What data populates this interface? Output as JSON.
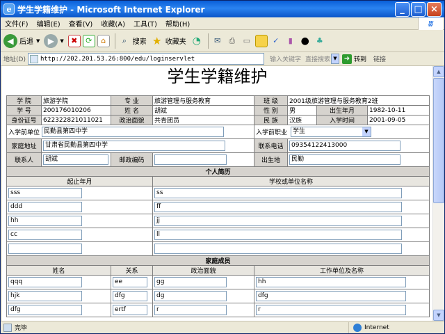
{
  "window": {
    "title": "学生学籍维护 - Microsoft Internet Explorer",
    "minimize": "_",
    "maximize": "□",
    "close": "×"
  },
  "menu": [
    "文件(F)",
    "编辑(E)",
    "查看(V)",
    "收藏(A)",
    "工具(T)",
    "帮助(H)"
  ],
  "toolbar": {
    "back": "后退",
    "search": "搜索",
    "favorites": "收藏夹"
  },
  "address": {
    "label": "地址(D)",
    "url": "http://202.201.53.26:800/edu/loginservlet",
    "keyword_hint": "输入关键字",
    "direct_search": "直接搜索",
    "go": "转到",
    "links": "链接"
  },
  "page": {
    "title": "学生学籍维护",
    "info": {
      "college_label": "学 院",
      "college": "旅游学院",
      "major_label": "专 业",
      "major": "旅游管理与服务教育",
      "class_label": "班 级",
      "class": "2001级旅游管理与服务教育2班",
      "id_label": "学 号",
      "id": "200176010206",
      "name_label": "姓 名",
      "name": "胡斌",
      "gender_label": "性 别",
      "gender": "男",
      "birth_label": "出生年月",
      "birth": "1982-10-11",
      "idcard_label": "身份证号",
      "idcard": "622322821011021",
      "political_label": "政治面貌",
      "political": "共青团员",
      "ethnic_label": "民 族",
      "ethnic": "汉族",
      "enroll_label": "入学时间",
      "enroll": "2001-09-05",
      "prev_unit_label": "入学前单位",
      "prev_unit": "民勤县第四中学",
      "prev_job_label": "入学前职业",
      "prev_job": "学生",
      "home_label": "家庭地址",
      "home": "甘肃省民勤县第四中学",
      "phone_label": "联系电话",
      "phone": "09354122413000",
      "contact_label": "联系人",
      "contact": "胡斌",
      "postcode_label": "邮政编码",
      "postcode": "",
      "birthplace_label": "出生地",
      "birthplace": "民勤"
    },
    "resume": {
      "title": "个人简历",
      "col_date": "起止年月",
      "col_school": "学校或单位名称",
      "rows": [
        {
          "date": "sss",
          "school": "ss"
        },
        {
          "date": "ddd",
          "school": "ff"
        },
        {
          "date": "hh",
          "school": "jj"
        },
        {
          "date": "cc",
          "school": "ll"
        },
        {
          "date": "",
          "school": ""
        }
      ]
    },
    "family": {
      "title": "家庭成员",
      "col_name": "姓名",
      "col_relation": "关系",
      "col_political": "政治面貌",
      "col_work": "工作单位及名称",
      "rows": [
        {
          "name": "qqq",
          "relation": "ee",
          "political": "gg",
          "work": "hh"
        },
        {
          "name": "hjk",
          "relation": "dfg",
          "political": "dg",
          "work": "dfg"
        },
        {
          "name": "dfg",
          "relation": "ertf",
          "political": "r",
          "work": "r"
        }
      ]
    }
  },
  "status": {
    "text": "完毕",
    "zone": "Internet"
  }
}
